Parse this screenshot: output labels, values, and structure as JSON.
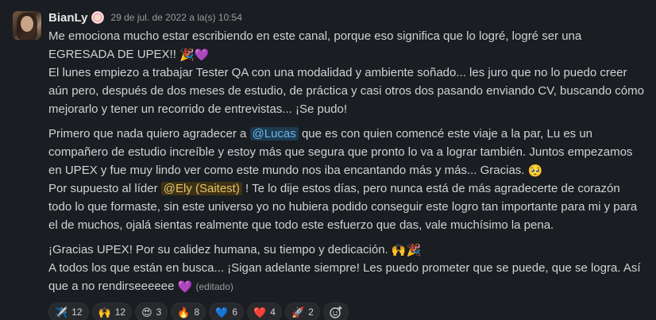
{
  "author": "BianLy",
  "timestamp": "29 de jul. de 2022 a la(s) 10:54",
  "body": {
    "p1_l1": "Me emociona mucho estar escribiendo en este canal, porque eso significa que lo logré, logré ser una EGRESADA",
    "p1_l2": "DE UPEX!!",
    "p1_l2_emojis": "🎉💜",
    "p1_l3": "El lunes empiezo a trabajar Tester QA con una modalidad y ambiente soñado... les juro que no lo puedo creer aún pero, después de dos meses de estudio, de práctica y casi otros dos pasando enviando CV, buscando cómo mejorarlo y tener un recorrido de entrevistas... ¡Se pudo!",
    "p2_pre": "Primero que nada quiero agradecer a",
    "mention_lucas": "@Lucas",
    "p2_post": "que es con quien comencé este viaje a la par, Lu es un compañero de estudio increíble y estoy más que segura que pronto lo va a lograr también. Juntos empezamos en UPEX y fue muy lindo ver como este mundo nos iba encantando más y más... Gracias.",
    "p2_emoji": "🥺",
    "p3_pre": "Por supuesto al líder",
    "mention_ely": "@Ely (Saitest)",
    "p3_post": "! Te lo dije estos días, pero nunca está de más agradecerte de corazón todo lo que formaste, sin este universo yo no hubiera podido conseguir este logro tan importante para mi y para el de muchos, ojalá sientas realmente que todo este esfuerzo que das, vale muchísimo la pena.",
    "p4": "¡Gracias UPEX! Por su calidez humana, su tiempo y dedicación.",
    "p4_emojis": "🙌🎉",
    "p5": "A todos los que están en busca... ¡Sigan adelante siempre! Les puedo prometer que se puede, que se logra. Así que a no rendirseeeeee",
    "p5_emoji": "💜",
    "edited": "(editado)"
  },
  "reactions": [
    {
      "emoji": "✈️",
      "icon": "airplane-icon",
      "count": "12"
    },
    {
      "emoji": "🙌",
      "icon": "raised-hands-icon",
      "count": "12"
    },
    {
      "emoji": "😍",
      "icon": "heart-eyes-icon",
      "count": "3"
    },
    {
      "emoji": "🔥",
      "icon": "fire-icon",
      "count": "8"
    },
    {
      "emoji": "💙",
      "icon": "blue-heart-icon",
      "count": "6"
    },
    {
      "emoji": "❤️",
      "icon": "red-heart-icon",
      "count": "4"
    },
    {
      "emoji": "🚀",
      "icon": "rocket-icon",
      "count": "2"
    }
  ],
  "colors": {
    "background": "#1a1d21",
    "mention_blue": "#6cb6e8",
    "mention_yellow": "#e8c468"
  }
}
